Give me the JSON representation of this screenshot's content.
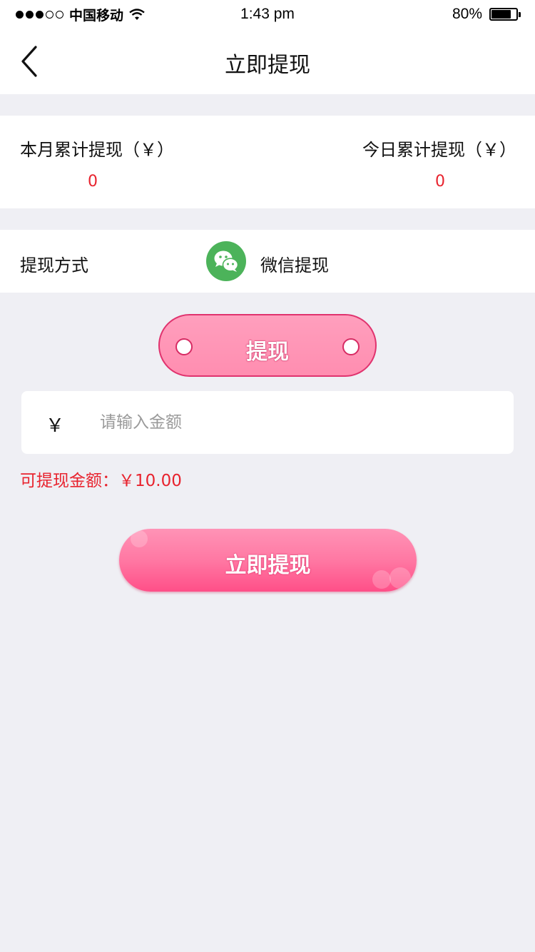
{
  "status_bar": {
    "carrier": "中国移动",
    "time": "1:43 pm",
    "battery": "80%",
    "battery_level": 0.8,
    "signal_bars_filled": 3,
    "signal_bars_total": 5
  },
  "nav": {
    "title": "立即提现",
    "back_icon": "chevron-left-icon"
  },
  "stats": {
    "month_label": "本月累计提现（￥）",
    "month_value": "0",
    "today_label": "今日累计提现（￥）",
    "today_value": "0"
  },
  "method": {
    "label": "提现方式",
    "icon": "wechat-icon",
    "value": "微信提现"
  },
  "tab": {
    "label": "提现"
  },
  "amount": {
    "currency": "￥",
    "placeholder": "请输入金额",
    "value": ""
  },
  "available": {
    "text": "可提现金额：￥10.00"
  },
  "submit": {
    "label": "立即提现"
  },
  "colors": {
    "accent_red": "#e8232e",
    "pink": "#ff78a3",
    "wechat_green": "#4cb35a",
    "background": "#efeff4"
  }
}
